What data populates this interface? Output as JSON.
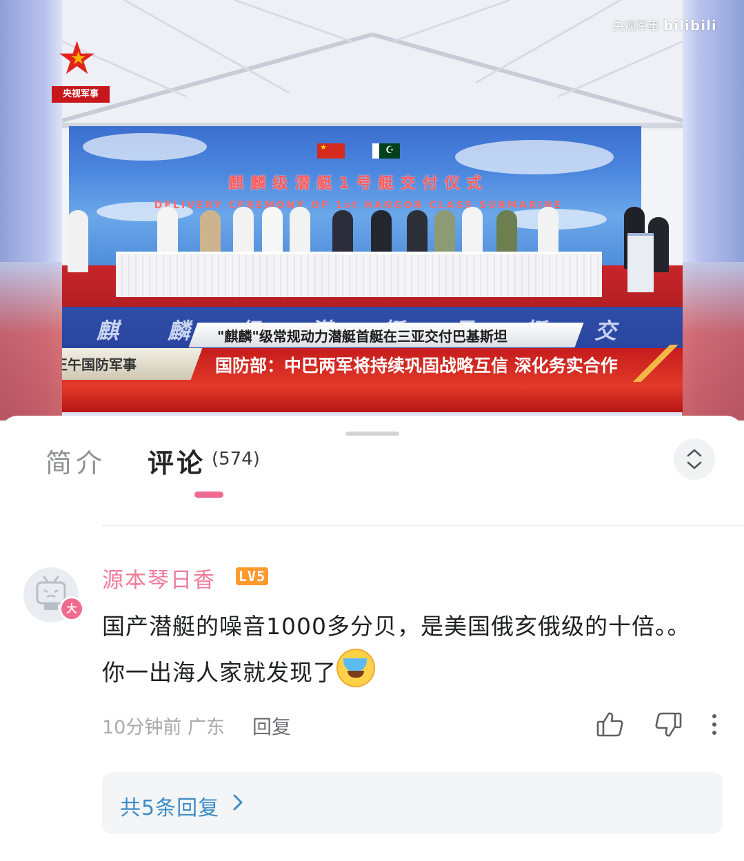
{
  "video": {
    "channel_watermark": "央视军事",
    "platform_watermark": "bilibili",
    "logo_label": "央视军事",
    "banner_title": "麒麟级潜艇1号艇交付仪式",
    "banner_subtitle": "DELIVERY CEREMONY OF 1st HANGOR CLASS SUBMARINE",
    "lower_caption": "麒 麟 级 潜 艇 号 艇 交 付 仪 式",
    "headline": "\"麒麟\"级常规动力潜艇首艇在三亚交付巴基斯坦",
    "program_name": "正午国防军事",
    "news_ticker": "国防部：中巴两军将持续巩固战略互信 深化务实合作"
  },
  "tabs": {
    "intro_label": "简介",
    "comments_label": "评论",
    "comments_count": "(574)"
  },
  "comment": {
    "avatar_badge": "大",
    "username": "源本琴日香",
    "level": "LV5",
    "text": "国产潜艇的噪音1000多分贝，是美国俄亥俄级的十倍。。你一出海人家就发现了",
    "time": "10分钟前",
    "location": "广东",
    "reply_label": "回复",
    "replies_summary": "共5条回复"
  },
  "colors": {
    "accent_pink": "#f06a92",
    "username_pink": "#f07a99",
    "link_blue": "#3c8cc7",
    "level_orange": "#ff9a2e"
  },
  "icons": {
    "collapse": "chevron-up-down-icon",
    "like": "thumbs-up-icon",
    "dislike": "thumbs-down-icon",
    "more": "more-vertical-icon",
    "replies_chevron": "chevron-right-icon",
    "emoji": "laugh-cry-emoji-icon"
  }
}
